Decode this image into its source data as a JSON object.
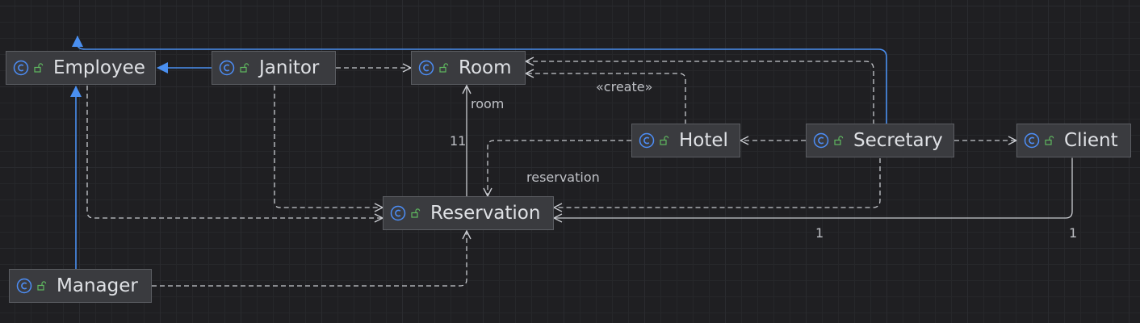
{
  "classes": [
    {
      "id": "employee",
      "name": "Employee"
    },
    {
      "id": "janitor",
      "name": "Janitor"
    },
    {
      "id": "room",
      "name": "Room"
    },
    {
      "id": "hotel",
      "name": "Hotel"
    },
    {
      "id": "secretary",
      "name": "Secretary"
    },
    {
      "id": "client",
      "name": "Client"
    },
    {
      "id": "reservation",
      "name": "Reservation"
    },
    {
      "id": "manager",
      "name": "Manager"
    }
  ],
  "labels": {
    "room": "room",
    "create": "«create»",
    "room_multiplicity": "11",
    "reservation": "reservation",
    "reservation_multiplicity": "1",
    "client_multiplicity": "1"
  },
  "colors": {
    "inheritance": "#4a8ff0",
    "dependency": "#c8cacf",
    "class_icon": "#4d8ef7",
    "public_icon": "#5fb85f"
  },
  "icons": {
    "class": "class-c-icon",
    "visibility": "public-lock-icon"
  }
}
